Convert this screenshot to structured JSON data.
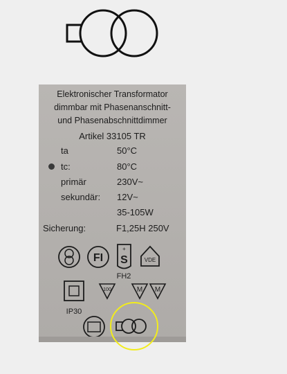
{
  "top_symbol": {
    "icon": "transformer-symbol-icon"
  },
  "label": {
    "header_line1": "Elektronischer Transformator",
    "header_line2": "dimmbar mit Phasenanschnitt-",
    "header_line3": "und Phasenabschnittdimmer",
    "article": "Artikel 33105 TR",
    "specs": [
      {
        "key": "ta",
        "value": "50°C"
      },
      {
        "key": "tc:",
        "value": "80°C"
      },
      {
        "key": "primär",
        "value": "230V~"
      },
      {
        "key": "sekundär:",
        "value": "12V~"
      },
      {
        "key": "",
        "value": "35-105W"
      }
    ],
    "fuse_key": "Sicherung:",
    "fuse_value": "F1,25H 250V",
    "cert_fi": "FI",
    "cert_fh2": "FH2",
    "cert_vde": "VDE",
    "rating_100": "100",
    "rating_m1": "M",
    "rating_m2": "M",
    "ip_rating": "IP30"
  },
  "highlight": {
    "color": "#f2ec1c"
  }
}
